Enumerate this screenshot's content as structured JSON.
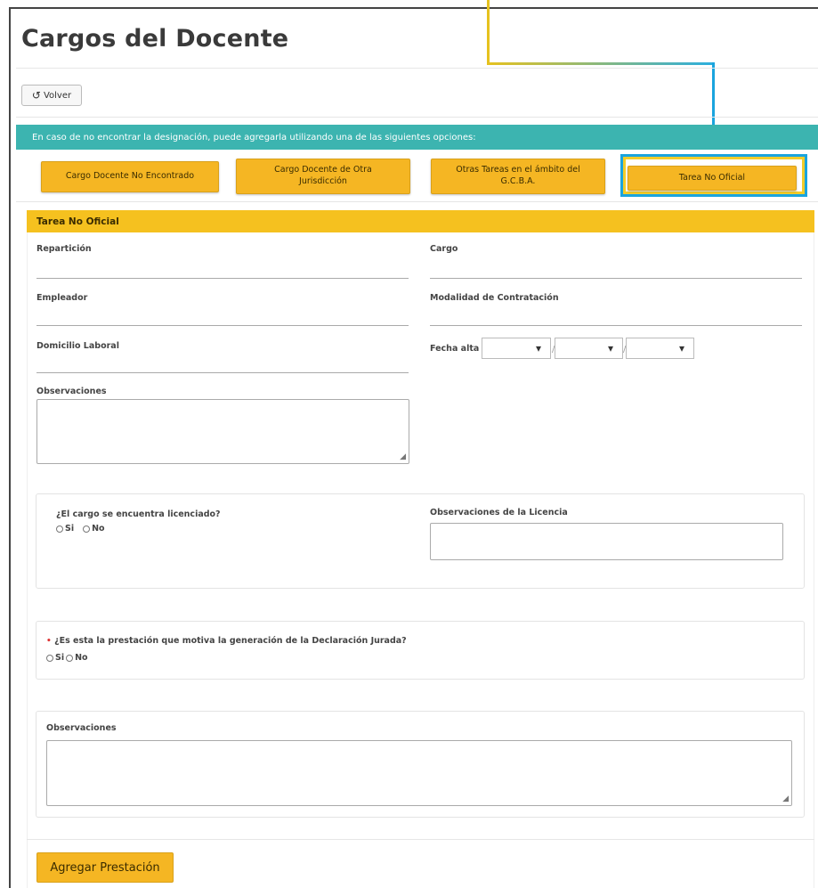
{
  "page": {
    "title": "Cargos del Docente"
  },
  "back_button": {
    "icon": "undo-icon",
    "label": "Volver"
  },
  "info_bar": {
    "text": "En caso de no encontrar la designación, puede agregarla utilizando una de las siguientes opciones:"
  },
  "options": [
    {
      "label": "Cargo Docente No Encontrado"
    },
    {
      "label": "Cargo Docente de Otra Jurisdicción"
    },
    {
      "label": "Otras Tareas en el ámbito del G.C.B.A."
    },
    {
      "label": "Tarea No Oficial"
    }
  ],
  "form": {
    "title": "Tarea No Oficial",
    "reparticion_label": "Repartición",
    "cargo_label": "Cargo",
    "empleador_label": "Empleador",
    "modalidad_label": "Modalidad de Contratación",
    "domicilio_label": "Domicilio Laboral",
    "fecha_alta_label": "Fecha alta",
    "date_separator": "/",
    "observaciones_label": "Observaciones",
    "licencia_question": "¿El cargo se encuentra licenciado?",
    "licencia_obs_label": "Observaciones de la Licencia",
    "yes": "Si",
    "no": "No",
    "required_mark": "•",
    "dj_question": "¿Es esta la prestación que motiva la generación de la Declaración Jurada?",
    "observaciones2_label": "Observaciones",
    "submit_label": "Agregar Prestación"
  },
  "colors": {
    "accent": "#f5b623",
    "info_bar": "#3cb4b0",
    "highlight": "#1aa4de"
  }
}
